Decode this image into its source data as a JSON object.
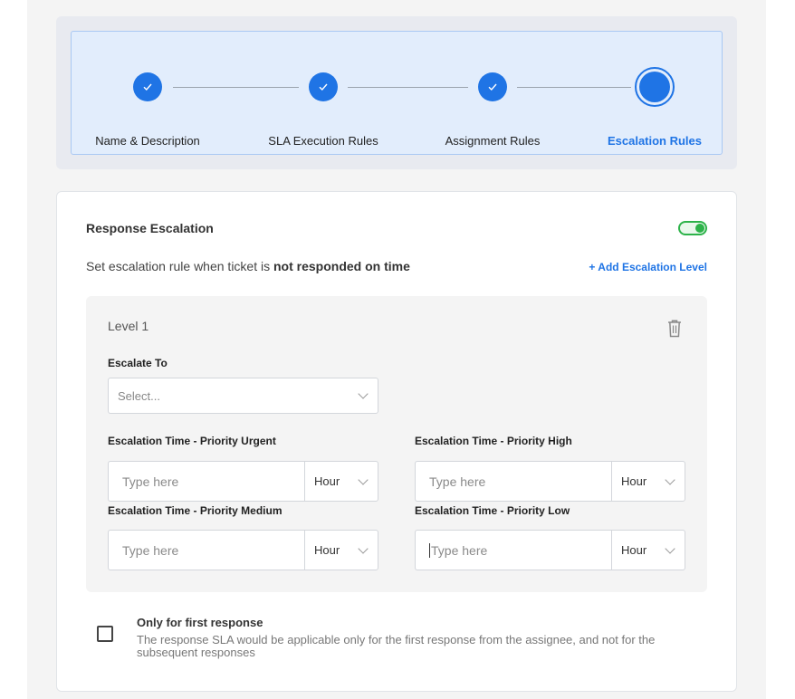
{
  "stepper": {
    "steps": [
      {
        "label": "Name & Description",
        "state": "completed"
      },
      {
        "label": "SLA Execution Rules",
        "state": "completed"
      },
      {
        "label": "Assignment Rules",
        "state": "completed"
      },
      {
        "label": "Escalation Rules",
        "state": "current"
      }
    ]
  },
  "escalation": {
    "title": "Response Escalation",
    "enabled": true,
    "description_prefix": "Set escalation rule when ticket is",
    "description_emphasis": "not responded on time",
    "add_level_label": "+ Add Escalation Level",
    "level": {
      "title": "Level 1",
      "escalate_to": {
        "label": "Escalate To",
        "placeholder": "Select..."
      },
      "times": {
        "urgent": {
          "label": "Escalation Time - Priority Urgent",
          "placeholder": "Type here",
          "unit": "Hour"
        },
        "high": {
          "label": "Escalation Time - Priority High",
          "placeholder": "Type here",
          "unit": "Hour"
        },
        "medium": {
          "label": "Escalation Time - Priority Medium",
          "placeholder": "Type here",
          "unit": "Hour"
        },
        "low": {
          "label": "Escalation Time - Priority Low",
          "placeholder": "Type here",
          "unit": "Hour"
        }
      }
    },
    "first_response": {
      "checked": false,
      "title": "Only for first response",
      "description": "The response SLA would be applicable only for the first response from the assignee, and not for the subsequent responses"
    }
  },
  "colors": {
    "accent": "#1f74e5",
    "toggle_on": "#2db34a"
  },
  "icons": [
    "check-icon",
    "trash-icon",
    "chevron-down-icon"
  ]
}
